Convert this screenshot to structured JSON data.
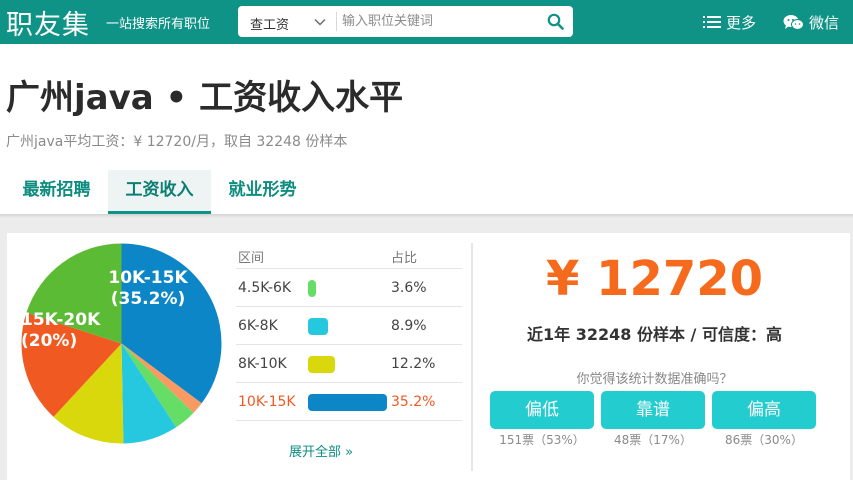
{
  "topbar": {
    "logo": "职友集",
    "slogan": "一站搜索所有职位",
    "search_type": "查工资",
    "search_placeholder": "输入职位关键词",
    "more_label": "更多",
    "wechat_label": "微信"
  },
  "header": {
    "title": "广州java • 工资收入水平",
    "subtitle": "广州java平均工资：¥ 12720/月，取自 32248 份样本"
  },
  "tabs": [
    {
      "label": "最新招聘",
      "active": false
    },
    {
      "label": "工资收入",
      "active": true
    },
    {
      "label": "就业形势",
      "active": false
    }
  ],
  "distribution": {
    "col_range": "区间",
    "col_ratio": "占比",
    "rows": [
      {
        "range": "4.5K-6K",
        "ratio": "3.6%",
        "value": 3.6,
        "color": "#66dd66",
        "highlight": false
      },
      {
        "range": "6K-8K",
        "ratio": "8.9%",
        "value": 8.9,
        "color": "#26c8e0",
        "highlight": false
      },
      {
        "range": "8K-10K",
        "ratio": "12.2%",
        "value": 12.2,
        "color": "#d8d80c",
        "highlight": false
      },
      {
        "range": "10K-15K",
        "ratio": "35.2%",
        "value": 35.2,
        "color": "#0c86c6",
        "highlight": true
      }
    ],
    "expand_label": "展开全部 »"
  },
  "pie": {
    "slices": [
      {
        "label": "10K-15K",
        "value": 35.2,
        "color": "#0c86c6"
      },
      {
        "label": "",
        "value": 2.0,
        "color": "#f99a62"
      },
      {
        "label": "4.5K-6K",
        "value": 3.6,
        "color": "#66dd66"
      },
      {
        "label": "6K-8K",
        "value": 8.9,
        "color": "#26c8e0"
      },
      {
        "label": "8K-10K",
        "value": 12.2,
        "color": "#d8d80c"
      },
      {
        "label": "",
        "value": 18.1,
        "color": "#f05a22"
      },
      {
        "label": "15K-20K",
        "value": 20.0,
        "color": "#5cbb34"
      }
    ],
    "label_big": {
      "line1": "10K-15K",
      "line2": "(35.2%)"
    },
    "label_small": {
      "line1": "15K-20K",
      "line2": "(20%)"
    }
  },
  "summary": {
    "salary": "¥ 12720",
    "sample_text": "近1年 32248 份样本 / 可信度：高",
    "question": "你觉得该统计数据准确吗？",
    "votes": [
      {
        "label": "偏低",
        "count": "151票（53%）"
      },
      {
        "label": "靠谱",
        "count": "48票（17%）"
      },
      {
        "label": "偏高",
        "count": "86票（30%）"
      }
    ]
  },
  "colors": {
    "brand": "#0e9386",
    "salary": "#f56a1c",
    "button": "#23ccce"
  }
}
